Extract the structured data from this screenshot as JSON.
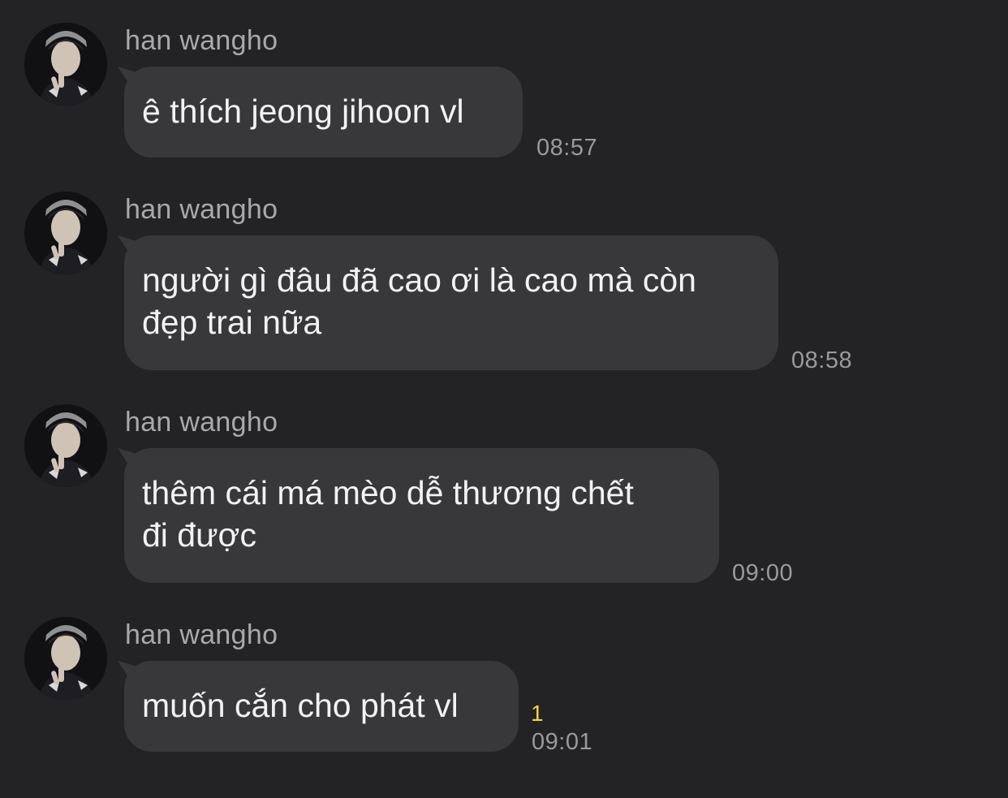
{
  "messages": [
    {
      "sender": "han wangho",
      "lines": [
        "ê thích jeong jihoon vl"
      ],
      "time": "08:57",
      "unread": ""
    },
    {
      "sender": "han wangho",
      "lines": [
        "người gì đâu đã cao ơi là cao mà còn",
        "đẹp trai nữa"
      ],
      "time": "08:58",
      "unread": ""
    },
    {
      "sender": "han wangho",
      "lines": [
        "thêm cái má mèo dễ thương chết",
        "đi được"
      ],
      "time": "09:00",
      "unread": ""
    },
    {
      "sender": "han wangho",
      "lines": [
        "muốn cắn cho phát vl"
      ],
      "time": "09:01",
      "unread": "1"
    }
  ],
  "colors": {
    "background": "#232325",
    "bubble": "#38383b",
    "text": "#f2f2f2",
    "muted": "#9a9a9e",
    "unread": "#f2d33b"
  },
  "icons": {
    "avatar": "profile-photo"
  }
}
